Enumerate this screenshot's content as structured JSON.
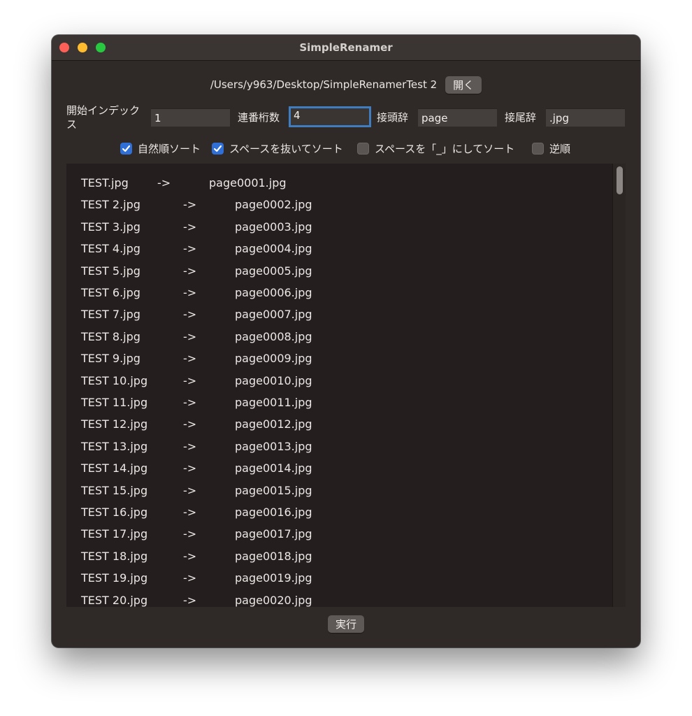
{
  "window": {
    "title": "SimpleRenamer"
  },
  "path": {
    "text": "/Users/y963/Desktop/SimpleRenamerTest 2",
    "open_label": "開く"
  },
  "params": {
    "start_index": {
      "label": "開始インデックス",
      "value": "1"
    },
    "digits": {
      "label": "連番桁数",
      "value": "4"
    },
    "prefix": {
      "label": "接頭辞",
      "value": "page"
    },
    "suffix": {
      "label": "接尾辞",
      "value": ".jpg"
    }
  },
  "options": [
    {
      "label": "自然順ソート",
      "checked": true
    },
    {
      "label": "スペースを抜いてソート",
      "checked": true
    },
    {
      "label": "スペースを「_」にしてソート",
      "checked": false
    },
    {
      "label": "逆順",
      "checked": false
    }
  ],
  "list": {
    "arrow": "->",
    "rows": [
      {
        "from": "TEST.jpg",
        "to": "page0001.jpg"
      },
      {
        "from": "TEST 2.jpg",
        "to": "page0002.jpg"
      },
      {
        "from": "TEST 3.jpg",
        "to": "page0003.jpg"
      },
      {
        "from": "TEST 4.jpg",
        "to": "page0004.jpg"
      },
      {
        "from": "TEST 5.jpg",
        "to": "page0005.jpg"
      },
      {
        "from": "TEST 6.jpg",
        "to": "page0006.jpg"
      },
      {
        "from": "TEST 7.jpg",
        "to": "page0007.jpg"
      },
      {
        "from": "TEST 8.jpg",
        "to": "page0008.jpg"
      },
      {
        "from": "TEST 9.jpg",
        "to": "page0009.jpg"
      },
      {
        "from": "TEST 10.jpg",
        "to": "page0010.jpg"
      },
      {
        "from": "TEST 11.jpg",
        "to": "page0011.jpg"
      },
      {
        "from": "TEST 12.jpg",
        "to": "page0012.jpg"
      },
      {
        "from": "TEST 13.jpg",
        "to": "page0013.jpg"
      },
      {
        "from": "TEST 14.jpg",
        "to": "page0014.jpg"
      },
      {
        "from": "TEST 15.jpg",
        "to": "page0015.jpg"
      },
      {
        "from": "TEST 16.jpg",
        "to": "page0016.jpg"
      },
      {
        "from": "TEST 17.jpg",
        "to": "page0017.jpg"
      },
      {
        "from": "TEST 18.jpg",
        "to": "page0018.jpg"
      },
      {
        "from": "TEST 19.jpg",
        "to": "page0019.jpg"
      },
      {
        "from": "TEST 20.jpg",
        "to": "page0020.jpg"
      }
    ]
  },
  "run_label": "実行"
}
